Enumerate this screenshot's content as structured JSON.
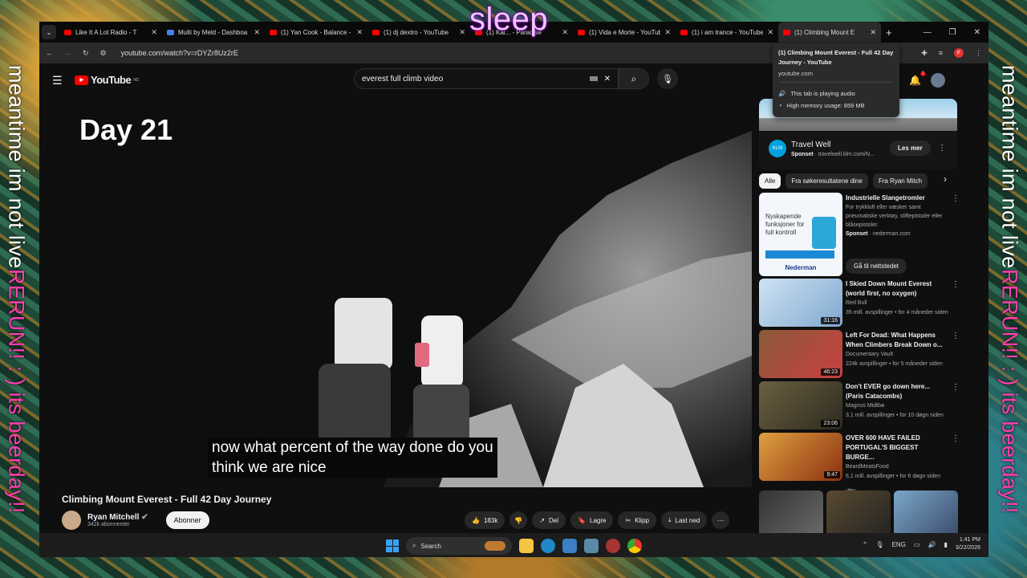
{
  "overlay": {
    "left_white": "meantime im not live ",
    "left_pink": "RERUN!! : ) its beerday!!",
    "right_white": "meantime im not live ",
    "right_pink": "RERUN!! : ) its beerday!!",
    "sleep": "sleep"
  },
  "browser": {
    "tabs": [
      {
        "title": "Like It A Lot Radio - T",
        "fav": "radio-favicon"
      },
      {
        "title": "Multi by Meld - Dashboa",
        "fav": "meld-favicon"
      },
      {
        "title": "(1) Yan Cook - Balance - Y",
        "fav": "youtube-favicon"
      },
      {
        "title": "(1) dj dextro - YouTube",
        "fav": "youtube-favicon"
      },
      {
        "title": "(1) Kai... - Paradise",
        "fav": "youtube-favicon"
      },
      {
        "title": "(1) Vida e Morte - YouTub",
        "fav": "youtube-favicon"
      },
      {
        "title": "(1) i am trance - YouTube",
        "fav": "youtube-favicon"
      },
      {
        "title": "(1) Climbing Mount E",
        "fav": "youtube-favicon",
        "active": true
      }
    ],
    "url": "youtube.com/watch?v=rDYZr8Uz2rE",
    "profile_initial": "F",
    "tooltip": {
      "title": "(1) Climbing Mount Everest - Full 42 Day Journey - YouTube",
      "domain": "youtube.com",
      "audio": "This tab is playing audio",
      "memory": "High memory usage: 859 MB"
    }
  },
  "youtube": {
    "logo": "YouTube",
    "region": "NO",
    "search_value": "everest full climb video",
    "create_partial": "ett",
    "notif_count": "1",
    "video": {
      "overlay_text": "Day 21",
      "caption": "now what percent of the way done do you\nthink we are nice",
      "title": "Climbing Mount Everest - Full 42 Day Journey"
    },
    "channel": {
      "name": "Ryan Mitchell",
      "subs": "342k abonnenter",
      "subscribe": "Abonner"
    },
    "actions": {
      "like": "183k",
      "share": "Del",
      "save": "Lagre",
      "clip": "Klipp",
      "download": "Last ned"
    },
    "ad": {
      "name": "Travel Well",
      "sponsored": "Sponset",
      "url": "travelwell.klm.com/N...",
      "cta": "Les mer",
      "logo": "KLM"
    },
    "chips": [
      "Alle",
      "Fra søkeresultatene dine",
      "Fra Ryan Mitch"
    ],
    "sponsored_video": {
      "title": "Industrielle Slangetromler",
      "desc": "For trykkluft eller væsker samt pneumatiske verktøy, stiftepistoler eller blåsepistoler.",
      "sponsored": "Sponset",
      "domain": "nederman.com",
      "cta": "Gå til nettstedet",
      "thumb_text": "Nyskapende funksjoner for full kontroll",
      "thumb_brand": "Nederman"
    },
    "recommendations": [
      {
        "title": "I Skied Down Mount Everest (world first, no oxygen)",
        "channel": "Red Bull",
        "meta": "35 mill. avspillinger • for 4 måneder siden",
        "duration": "31:16",
        "color1": "#cfe3f4",
        "color2": "#7fa8cf"
      },
      {
        "title": "Left For Dead: What Happens When Climbers Break Down o...",
        "channel": "Documentary Vault",
        "meta": "224k avspillinger • for 5 måneder siden",
        "duration": "46:23",
        "color1": "#8a5a3a",
        "color2": "#c94040"
      },
      {
        "title": "Don't EVER go down here... (Paris Catacombs)",
        "channel": "Magnus Midtbø",
        "meta": "3,1 mill. avspillinger • for 10 døgn siden",
        "duration": "23:06",
        "color1": "#6a6040",
        "color2": "#2e2a20"
      },
      {
        "title": "OVER 600 HAVE FAILED PORTUGAL'S BIGGEST BURGE...",
        "channel": "BeardMeatsFood",
        "meta": "6,1 mill. avspillinger • for 6 døgn siden",
        "duration": "9:47",
        "badge": "Ny",
        "color1": "#e0a040",
        "color2": "#8a3010"
      }
    ]
  },
  "taskbar": {
    "search": "Search",
    "lang": "ENG",
    "time": "1:41 PM",
    "date": "3/22/2026"
  }
}
